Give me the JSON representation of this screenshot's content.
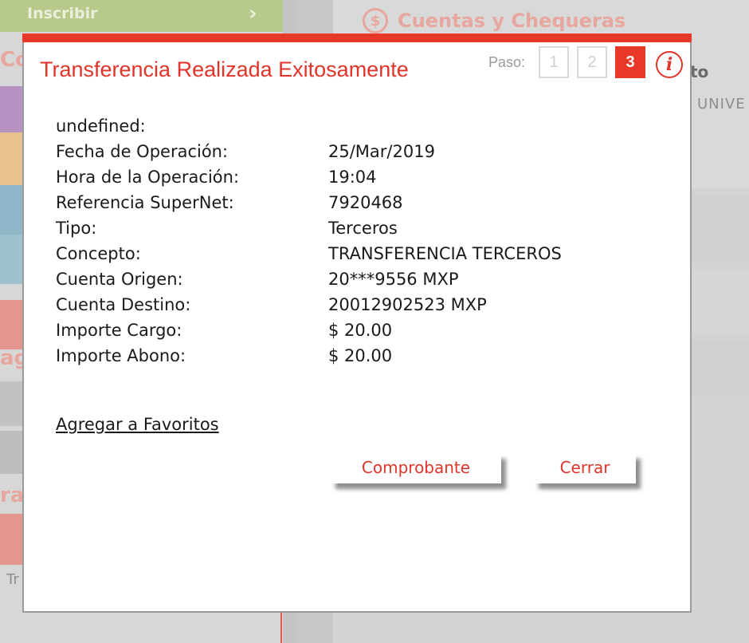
{
  "background": {
    "inscribir_label": "Inscribir",
    "panel_title": "Cuentas y Chequeras",
    "partial_to": "to",
    "partial_unive": "UNIVE",
    "partial_co": "Có",
    "partial_ag": "ag",
    "partial_ra": "ra",
    "partial_tr": "Tr"
  },
  "modal": {
    "title": "Transferencia Realizada Exitosamente",
    "steps_label": "Paso:",
    "steps": [
      {
        "label": "1",
        "active": false
      },
      {
        "label": "2",
        "active": false
      },
      {
        "label": "3",
        "active": true
      }
    ],
    "info_symbol": "i",
    "details": [
      {
        "label": "undefined:",
        "value": ""
      },
      {
        "label": "Fecha de Operación:",
        "value": "25/Mar/2019"
      },
      {
        "label": "Hora de la Operación:",
        "value": "19:04"
      },
      {
        "label": "Referencia SuperNet:",
        "value": "7920468"
      },
      {
        "label": "Tipo:",
        "value": "Terceros"
      },
      {
        "label": "Concepto:",
        "value": "TRANSFERENCIA TERCEROS"
      },
      {
        "label": "Cuenta Origen:",
        "value": "20***9556 MXP"
      },
      {
        "label": "Cuenta Destino:",
        "value": "20012902523 MXP"
      },
      {
        "label": "Importe Cargo:",
        "value": "$ 20.00"
      },
      {
        "label": "Importe Abono:",
        "value": "$ 20.00"
      }
    ],
    "favorites_link": "Agregar a Favoritos",
    "receipt_button": "Comprobante",
    "close_button": "Cerrar"
  },
  "colors": {
    "accent": "#e8382a",
    "text": "#1a1a1a"
  }
}
